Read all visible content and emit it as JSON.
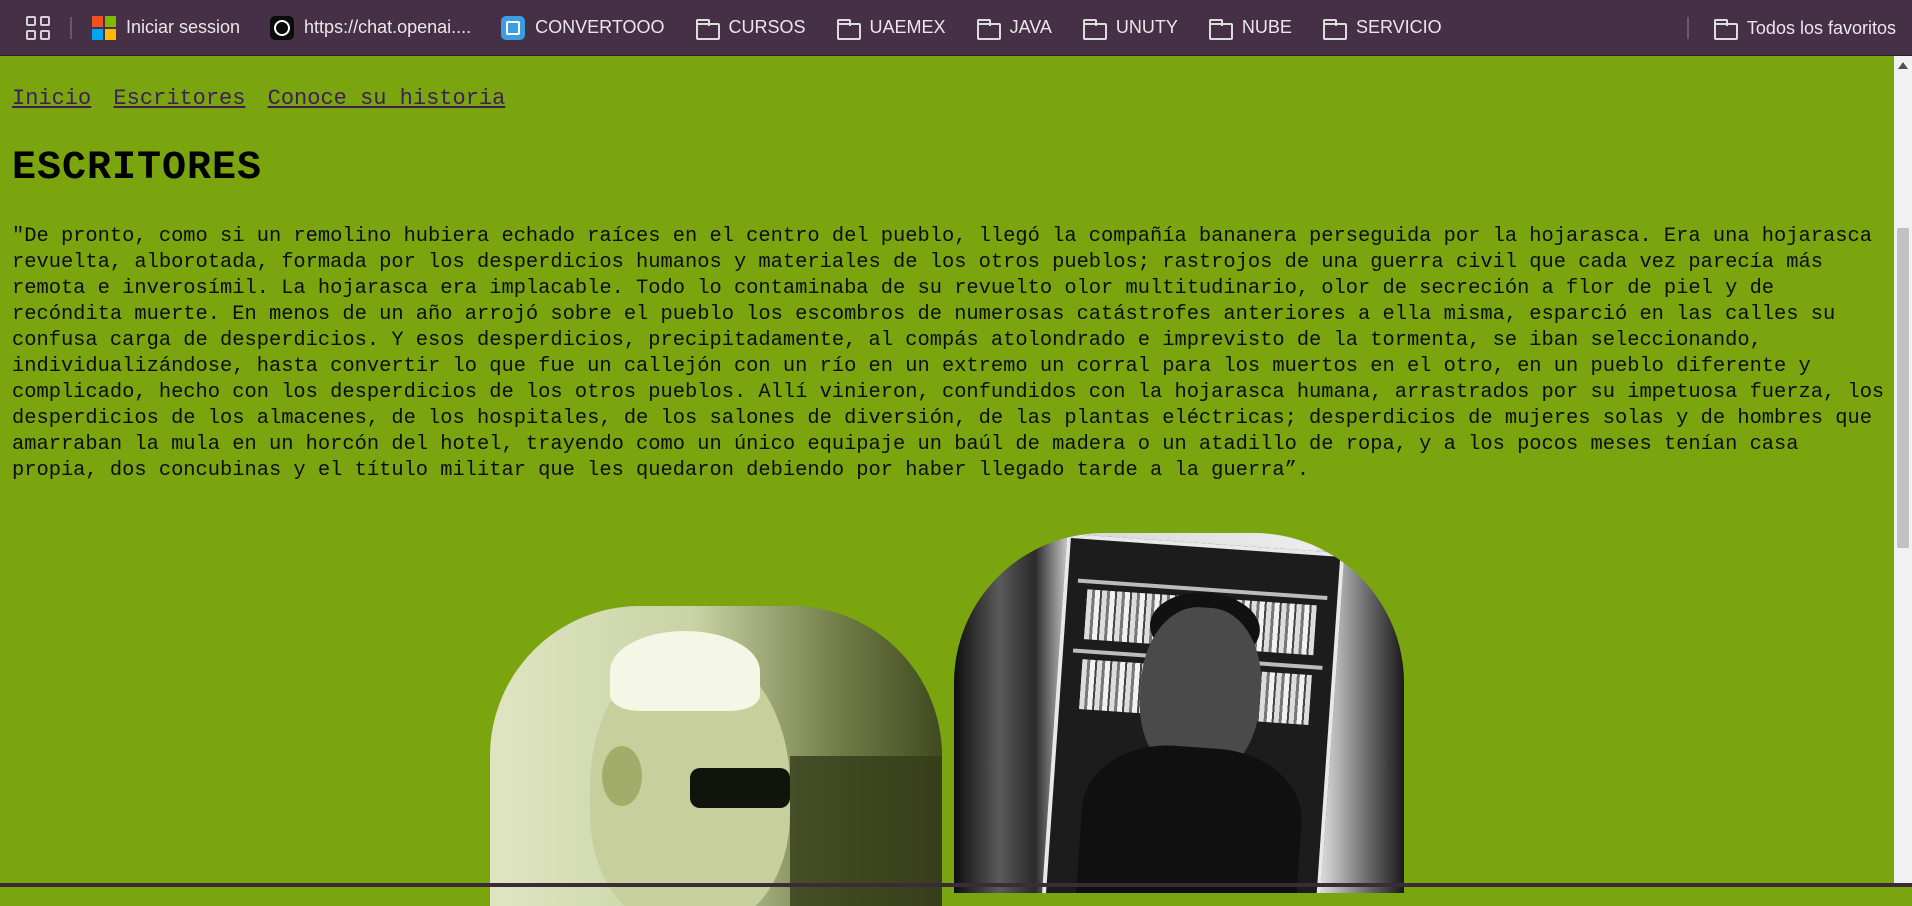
{
  "bookmarks_bar": {
    "items": [
      {
        "label": "Iniciar session",
        "icon": "microsoft-logo-icon"
      },
      {
        "label": "https://chat.openai....",
        "icon": "chatgpt-icon"
      },
      {
        "label": "CONVERTOOO",
        "icon": "convertooo-icon"
      },
      {
        "label": "CURSOS",
        "icon": "folder-icon"
      },
      {
        "label": "UAEMEX",
        "icon": "folder-icon"
      },
      {
        "label": "JAVA",
        "icon": "folder-icon"
      },
      {
        "label": "UNUTY",
        "icon": "folder-icon"
      },
      {
        "label": "NUBE",
        "icon": "folder-icon"
      },
      {
        "label": "SERVICIO",
        "icon": "folder-icon"
      }
    ],
    "all_favorites": "Todos los favoritos"
  },
  "nav": {
    "links": [
      "Inicio",
      "Escritores",
      "Conoce su historia"
    ]
  },
  "page": {
    "title": "ESCRITORES",
    "quote": "\"De pronto, como si un remolino hubiera echado raíces en el centro del pueblo, llegó la compañía bananera perseguida por la hojarasca. Era una hojarasca revuelta, alborotada, formada por los desperdicios humanos y materiales de los otros pueblos; rastrojos de una guerra civil que cada vez parecía más remota e inverosímil. La hojarasca era implacable. Todo lo contaminaba de su revuelto olor multitudinario, olor de secreción a flor de piel y de recóndita muerte. En menos de un año arrojó sobre el pueblo los escombros de numerosas catástrofes anteriores a ella misma, esparció en las calles su confusa carga de desperdicios. Y esos desperdicios, precipitadamente, al compás atolondrado e imprevisto de la tormenta, se iban seleccionando, individualizándose, hasta convertir lo que fue un callejón con un río en un extremo un corral para los muertos en el otro, en un pueblo diferente y complicado, hecho con los desperdicios de los otros pueblos. Allí vinieron, confundidos con la hojarasca humana, arrastrados por su impetuosa fuerza, los desperdicios de los almacenes, de los hospitales, de los salones de diversión, de las plantas eléctricas; desperdicios de mujeres solas y de hombres que amarraban la mula en un horcón del hotel, trayendo como un único equipaje un baúl de madera o un atadillo de ropa, y a los pocos meses tenían casa propia, dos concubinas y el título militar que les quedaron debiendo por haber llegado tarde a la guerra”."
  },
  "colors": {
    "page_background": "#7aa50f",
    "bookmarks_background": "#453045",
    "nav_link": "#3e1f55"
  }
}
